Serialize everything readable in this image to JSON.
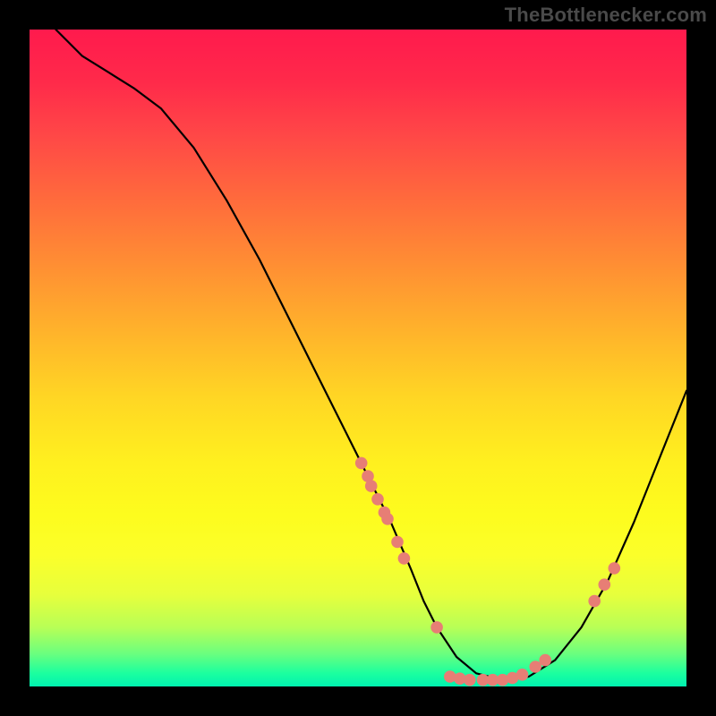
{
  "watermark": "TheBottlenecker.com",
  "chart_data": {
    "type": "line",
    "title": "",
    "xlabel": "",
    "ylabel": "",
    "xlim": [
      0,
      100
    ],
    "ylim": [
      0,
      100
    ],
    "series": [
      {
        "name": "curve",
        "x": [
          4,
          8,
          12,
          16,
          20,
          25,
          30,
          35,
          40,
          45,
          50,
          55,
          58,
          60,
          62,
          65,
          68,
          72,
          76,
          80,
          84,
          88,
          92,
          96,
          100
        ],
        "y": [
          100,
          96,
          93.5,
          91,
          88,
          82,
          74,
          65,
          55,
          45,
          35,
          25,
          18,
          13,
          9,
          4.5,
          2,
          1,
          1.5,
          4,
          9,
          16,
          25,
          35,
          45
        ]
      }
    ],
    "markers": {
      "name": "highlight-points",
      "color": "#e77e75",
      "points": [
        {
          "x": 50.5,
          "y": 34
        },
        {
          "x": 51.5,
          "y": 32
        },
        {
          "x": 52,
          "y": 30.5
        },
        {
          "x": 53,
          "y": 28.5
        },
        {
          "x": 54,
          "y": 26.5
        },
        {
          "x": 54.5,
          "y": 25.5
        },
        {
          "x": 56,
          "y": 22
        },
        {
          "x": 57,
          "y": 19.5
        },
        {
          "x": 62,
          "y": 9
        },
        {
          "x": 64,
          "y": 1.5
        },
        {
          "x": 65.5,
          "y": 1.2
        },
        {
          "x": 67,
          "y": 1
        },
        {
          "x": 69,
          "y": 1
        },
        {
          "x": 70.5,
          "y": 1
        },
        {
          "x": 72,
          "y": 1
        },
        {
          "x": 73.5,
          "y": 1.3
        },
        {
          "x": 75,
          "y": 1.8
        },
        {
          "x": 77,
          "y": 3
        },
        {
          "x": 78.5,
          "y": 4
        },
        {
          "x": 86,
          "y": 13
        },
        {
          "x": 87.5,
          "y": 15.5
        },
        {
          "x": 89,
          "y": 18
        }
      ]
    }
  }
}
